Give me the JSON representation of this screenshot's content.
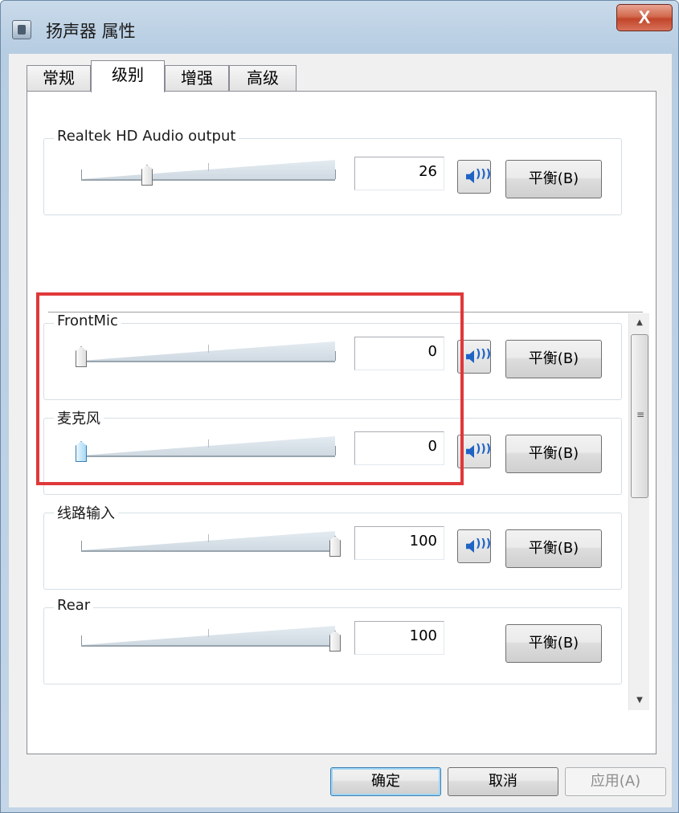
{
  "window": {
    "title": "扬声器 属性",
    "close_label": "X"
  },
  "tabs": [
    {
      "label": "常规",
      "active": false
    },
    {
      "label": "级别",
      "active": true
    },
    {
      "label": "增强",
      "active": false
    },
    {
      "label": "高级",
      "active": false
    }
  ],
  "output": {
    "label": "Realtek HD Audio output",
    "value": "26",
    "level": 0.26,
    "balance_label": "平衡(B)",
    "speaker_icon": "speaker-icon"
  },
  "inputs": [
    {
      "label": "FrontMic",
      "value": "0",
      "level": 0.0,
      "balance_label": "平衡(B)",
      "has_speaker": true,
      "focused": false
    },
    {
      "label": "麦克风",
      "value": "0",
      "level": 0.0,
      "balance_label": "平衡(B)",
      "has_speaker": true,
      "focused": true
    },
    {
      "label": "线路输入",
      "value": "100",
      "level": 1.0,
      "balance_label": "平衡(B)",
      "has_speaker": true,
      "focused": false
    },
    {
      "label": "Rear",
      "value": "100",
      "level": 1.0,
      "balance_label": "平衡(B)",
      "has_speaker": false,
      "focused": false
    }
  ],
  "scrollbar": {
    "up_arrow": "▲",
    "down_arrow": "▼",
    "grip": "≡"
  },
  "footer": {
    "ok_label": "确定",
    "cancel_label": "取消",
    "apply_label": "应用(A)"
  },
  "colors": {
    "highlight": "#e0383a",
    "speaker_blue": "#1f64c4"
  }
}
